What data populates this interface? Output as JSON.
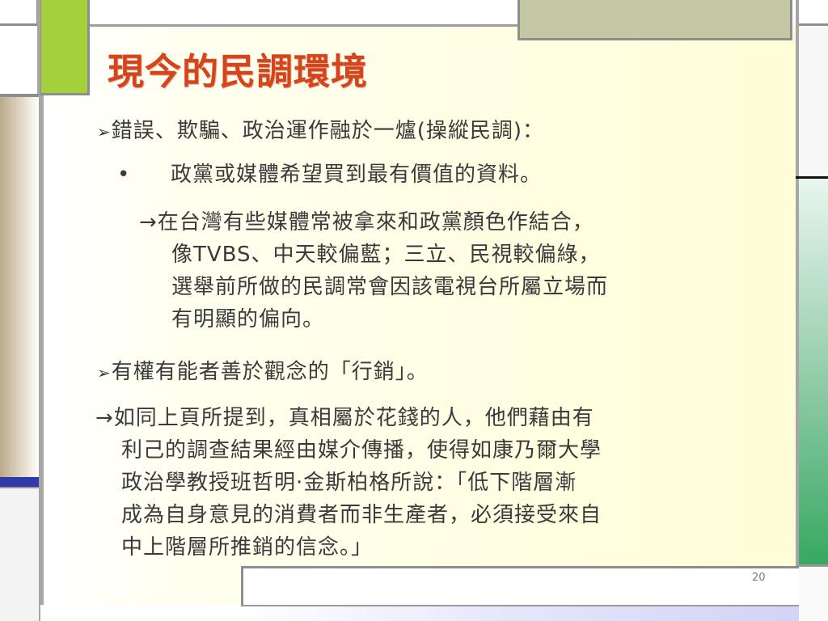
{
  "slide": {
    "title": "現今的民調環境",
    "page_number": "20",
    "bullet1": {
      "marker": "➢",
      "text": "錯誤、欺騙、政治運作融於一爐(操縱民調)："
    },
    "sub_bullet": {
      "marker": "•",
      "text": "政黨或媒體希望買到最有價值的資料。"
    },
    "arrow_para1": {
      "lines": [
        "→在台灣有些媒體常被拿來和政黨顏色作結合，",
        "像TVBS、中天較偏藍；三立、民視較偏綠，",
        "選舉前所做的民調常會因該電視台所屬立場而",
        "有明顯的偏向。"
      ]
    },
    "bullet2": {
      "marker": "➢",
      "text": "有權有能者善於觀念的「行銷」。"
    },
    "arrow_para2": {
      "lines": [
        "→如同上頁所提到，真相屬於花錢的人，他們藉由有",
        "利己的調查結果經由媒介傳播，使得如康乃爾大學",
        "政治學教授班哲明·金斯柏格所說：「低下階層漸",
        "成為自身意見的消費者而非生產者，必須接受來自",
        "中上階層所推銷的信念。」"
      ]
    }
  }
}
